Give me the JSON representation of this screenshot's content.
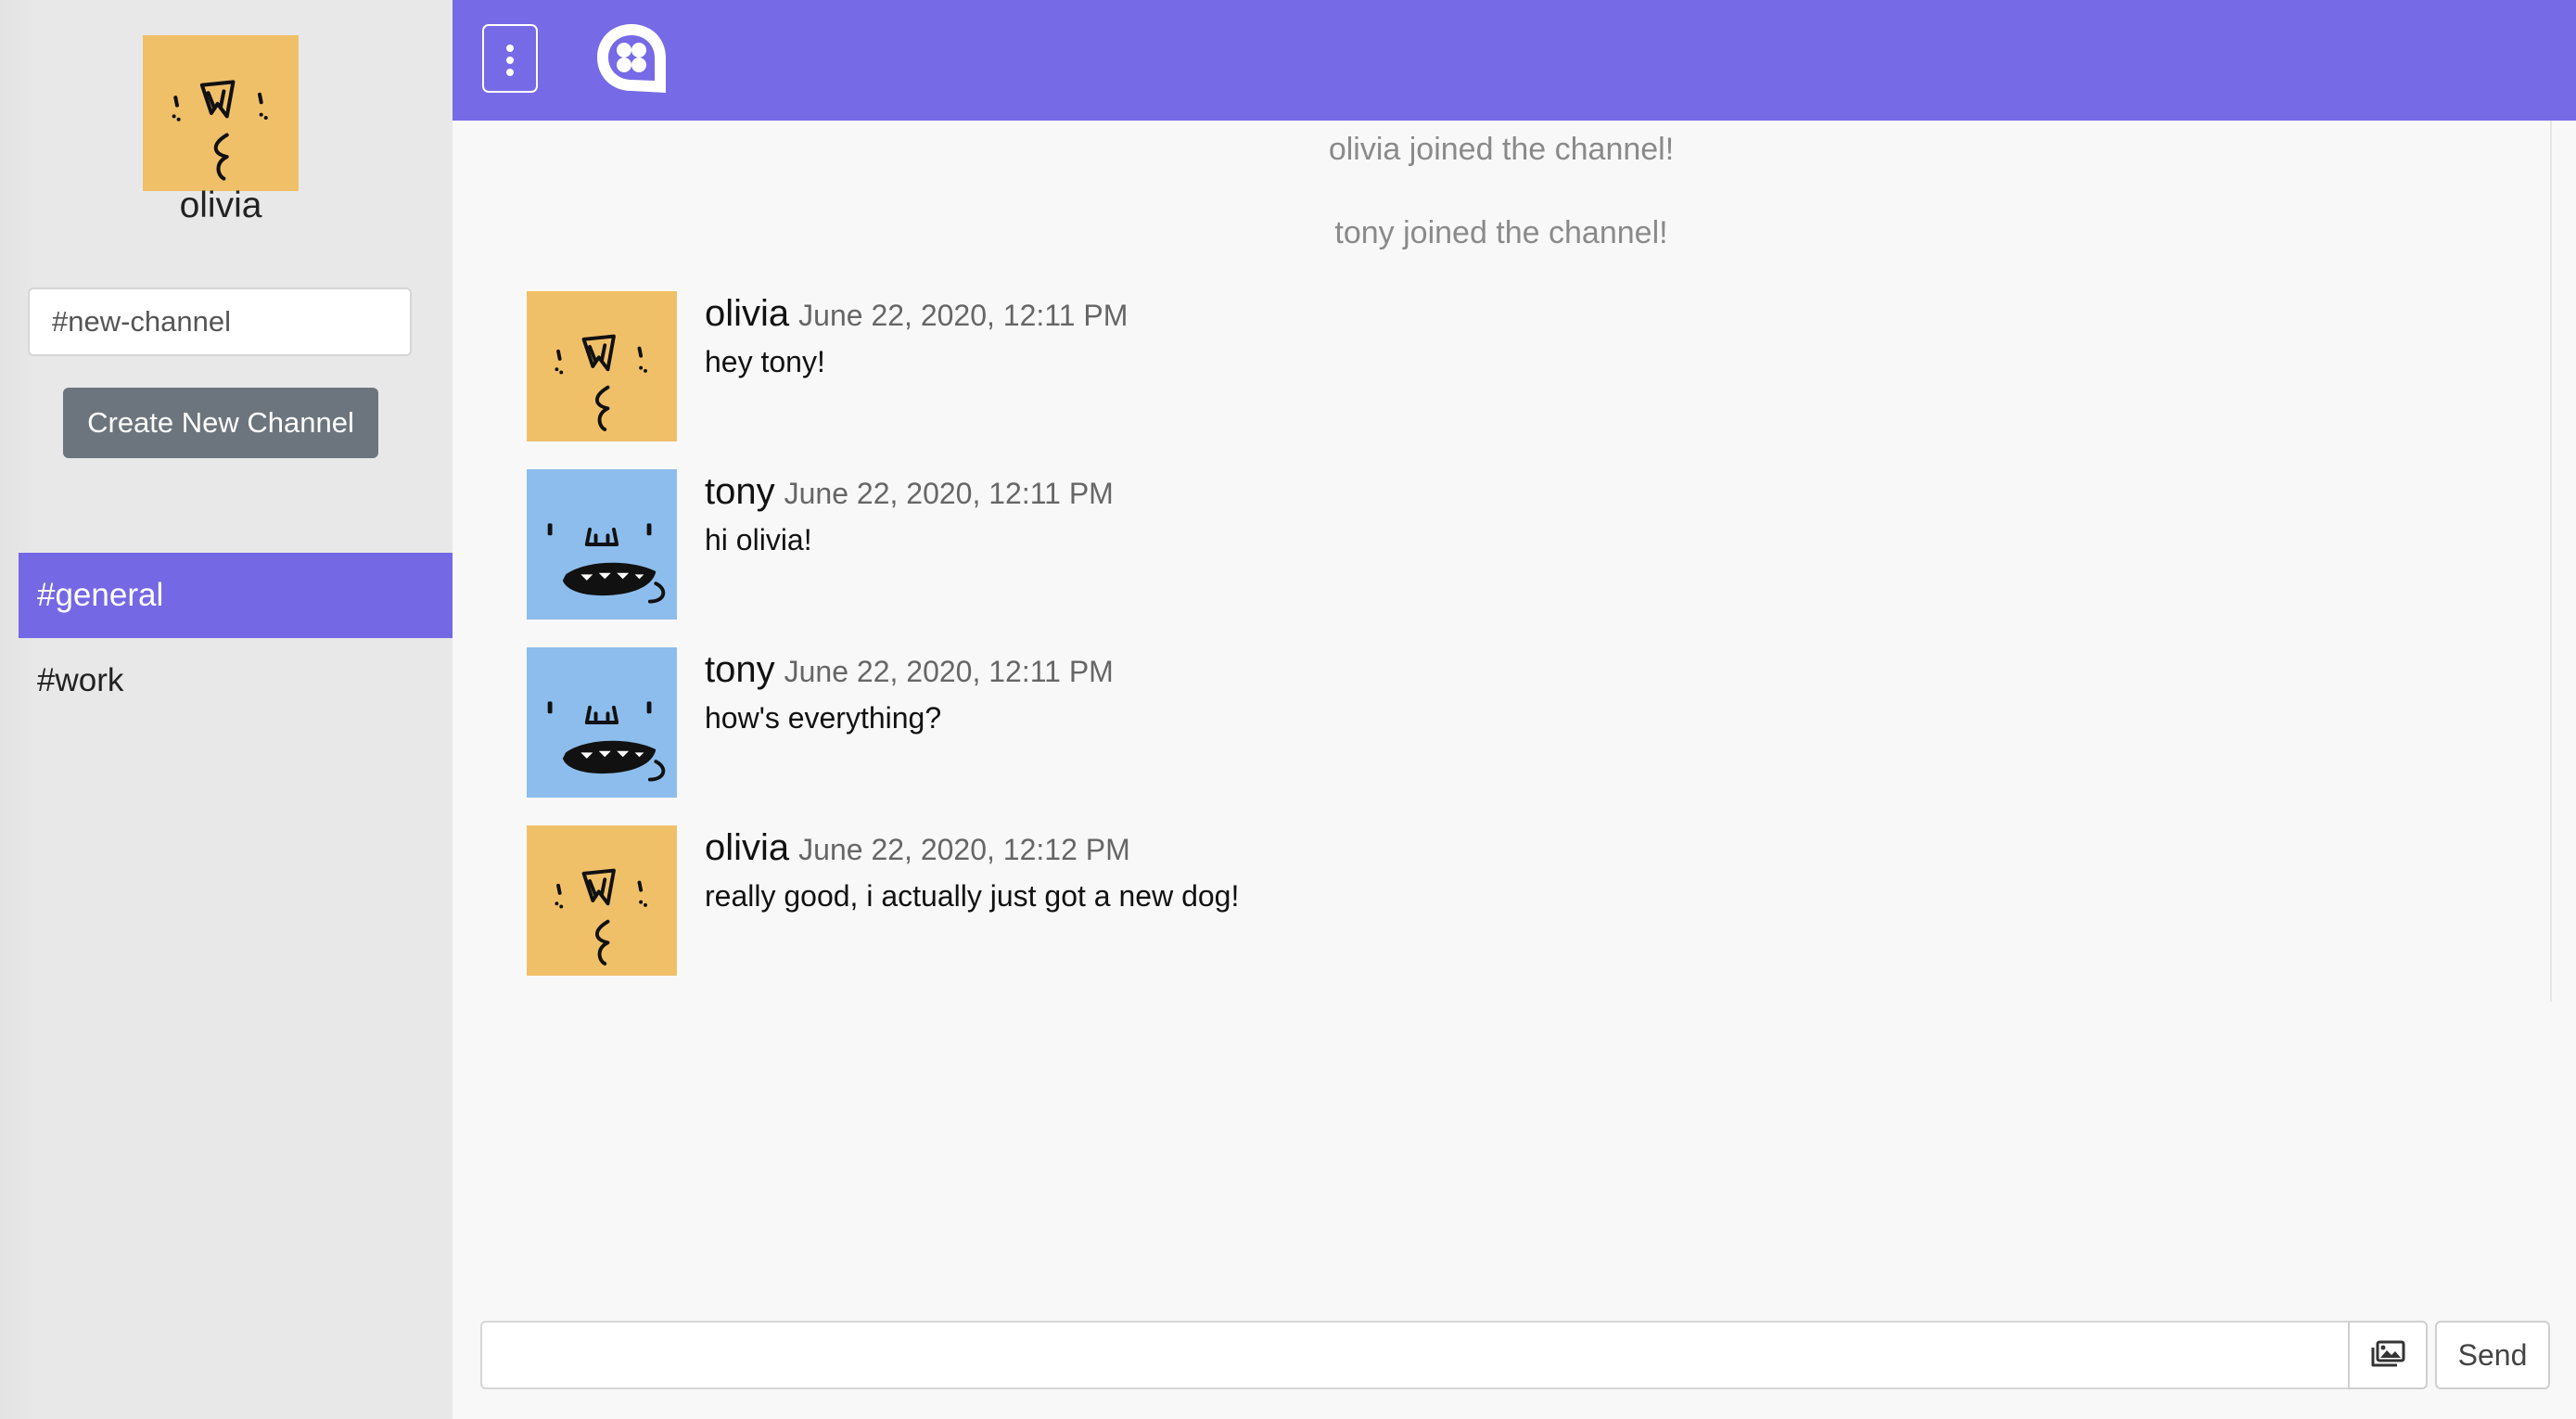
{
  "user": {
    "name": "olivia",
    "avatar": "orange-doodle-face"
  },
  "sidebar": {
    "new_channel_placeholder": "#new-channel",
    "create_button_label": "Create New Channel",
    "channels": [
      {
        "label": "#general",
        "active": true
      },
      {
        "label": "#work",
        "active": false
      }
    ]
  },
  "topbar": {
    "menu_icon": "vertical-ellipsis-icon",
    "logo_icon": "chat-bubble-logo-icon"
  },
  "feed": {
    "system_messages": [
      "olivia joined the channel!",
      "tony joined the channel!"
    ],
    "messages": [
      {
        "author": "olivia",
        "time": "June 22, 2020, 12:11 PM",
        "text": "hey tony!",
        "avatar": "orange-doodle-face"
      },
      {
        "author": "tony",
        "time": "June 22, 2020, 12:11 PM",
        "text": "hi olivia!",
        "avatar": "blue-doodle-face"
      },
      {
        "author": "tony",
        "time": "June 22, 2020, 12:11 PM",
        "text": "how's everything?",
        "avatar": "blue-doodle-face"
      },
      {
        "author": "olivia",
        "time": "June 22, 2020, 12:12 PM",
        "text": "really good, i actually just got a new dog!",
        "avatar": "orange-doodle-face"
      }
    ]
  },
  "composer": {
    "value": "",
    "image_icon": "image-upload-icon",
    "send_label": "Send"
  },
  "colors": {
    "accent": "#766ae6",
    "sidebar_bg": "#e8e8e8",
    "orange_avatar": "#f0c069",
    "blue_avatar": "#8dbdec"
  }
}
